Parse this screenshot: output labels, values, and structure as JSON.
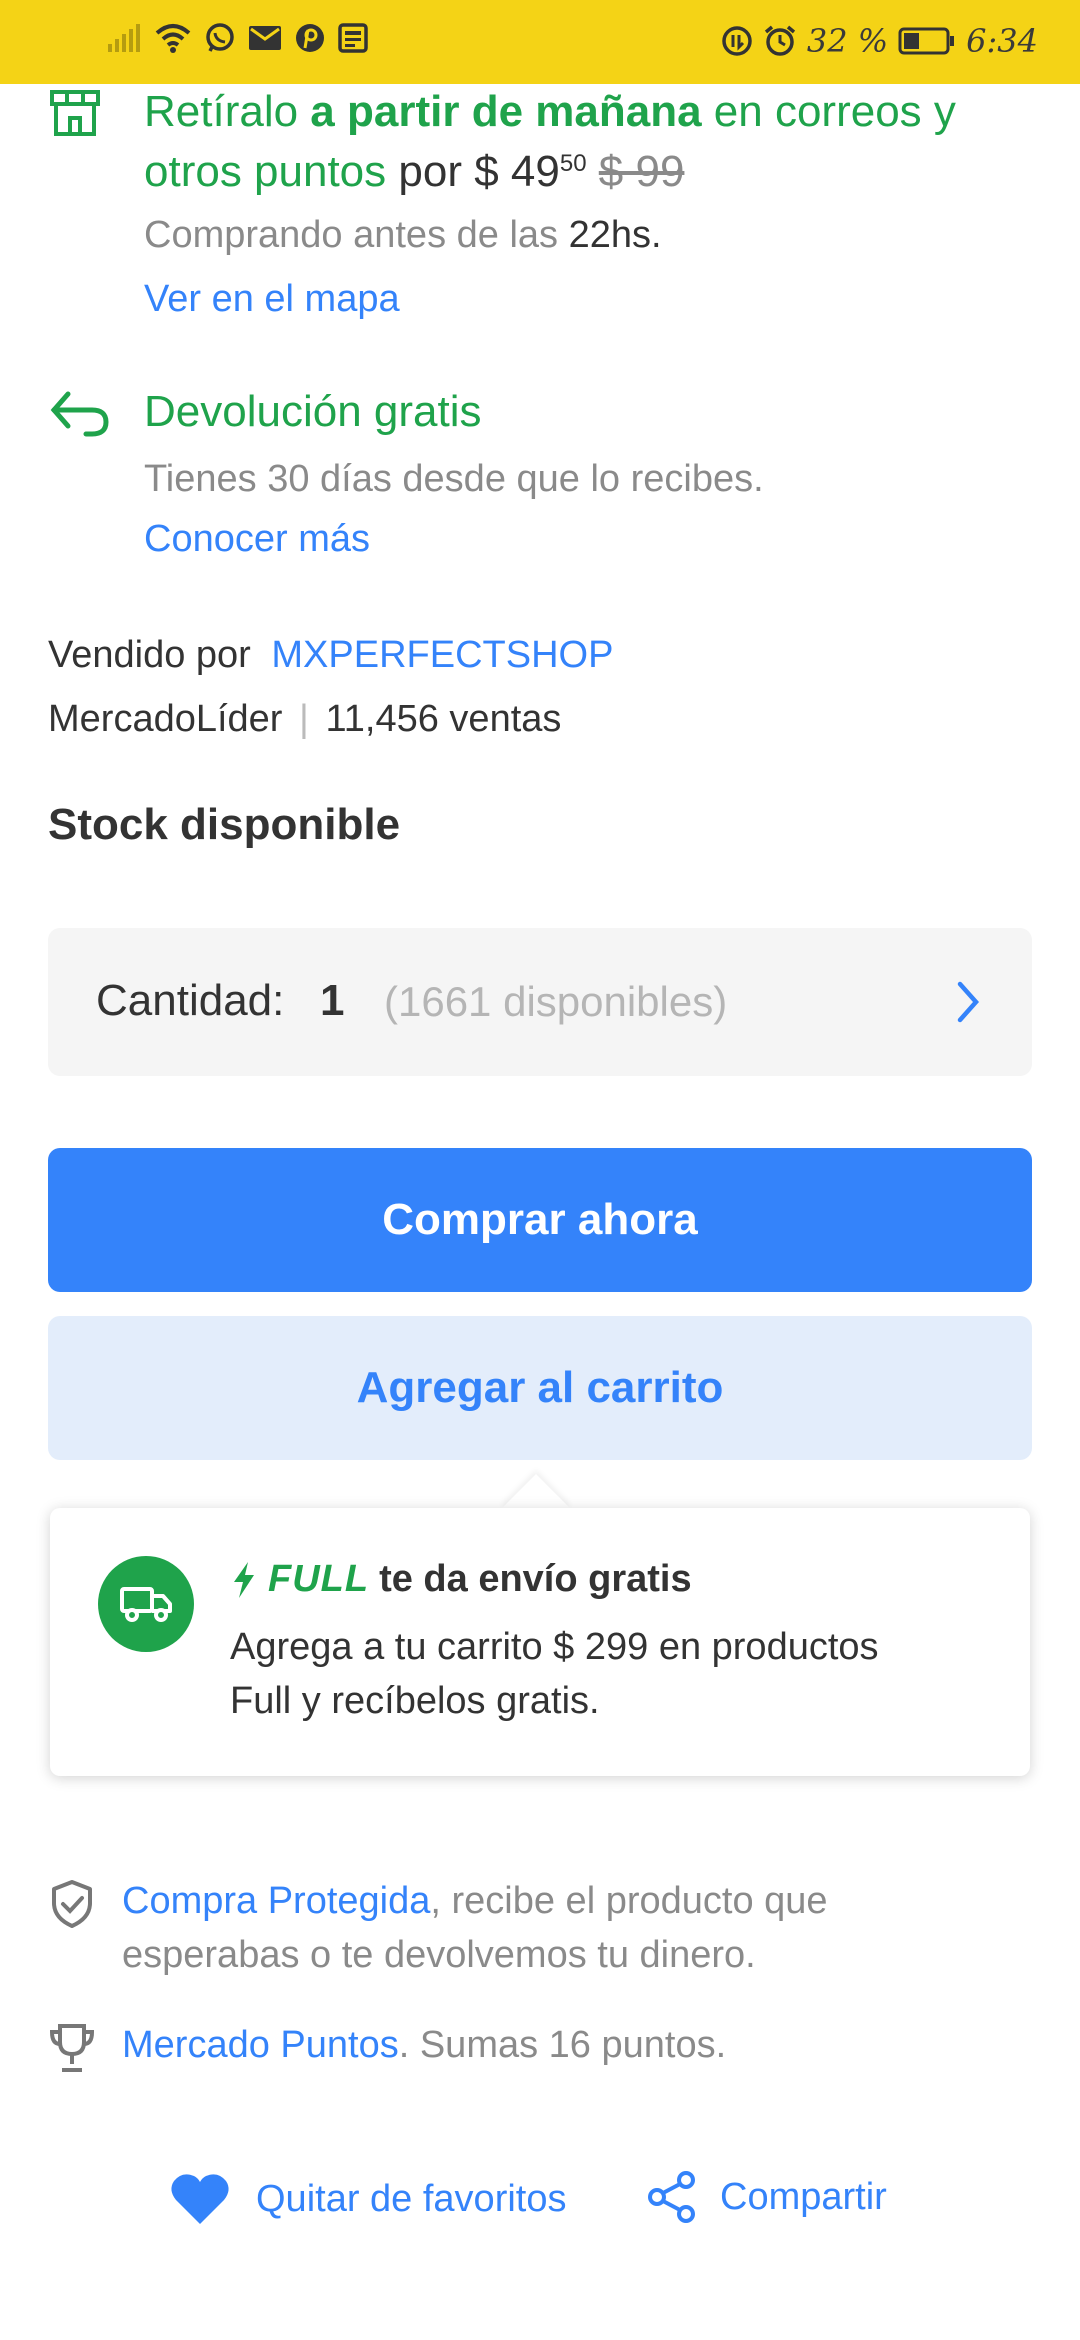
{
  "status_bar": {
    "battery_percent": "32 %",
    "time": "6:34"
  },
  "pickup": {
    "prefix": "Retíralo ",
    "highlight": "a partir de mañana",
    "suffix": " en correos y otros puntos",
    "por": " por ",
    "price_currency": "$ 49",
    "price_cents": "50",
    "old_price": "$ 99",
    "note_prefix": "Comprando antes de las ",
    "note_time": "22hs.",
    "map_link": "Ver en el mapa"
  },
  "returns": {
    "title": "Devolución gratis",
    "note": "Tienes 30 días desde que lo recibes.",
    "link": "Conocer más"
  },
  "seller": {
    "sold_by_label": "Vendido por",
    "name": "MXPERFECTSHOP",
    "level": "MercadoLíder",
    "separator": "|",
    "sales": "11,456 ventas"
  },
  "stock": {
    "title": "Stock disponible",
    "quantity_label": "Cantidad:",
    "quantity_value": "1",
    "available": "(1661 disponibles)"
  },
  "buttons": {
    "buy_now": "Comprar ahora",
    "add_to_cart": "Agregar al carrito"
  },
  "full_promo": {
    "brand": "FULL",
    "title_suffix": "te da envío gratis",
    "line1": "Agrega a tu carrito $ 299 en productos",
    "line2": "Full y recíbelos gratis."
  },
  "protection": {
    "link": "Compra Protegida",
    "line1_rest": ", recibe el producto que",
    "line2": "esperabas o te devolvemos tu dinero."
  },
  "points": {
    "link": "Mercado Puntos",
    "rest": ". Sumas 16 puntos."
  },
  "actions": {
    "favorite": "Quitar de favoritos",
    "share": "Compartir"
  },
  "colors": {
    "statusbar": "#f4d316",
    "green": "#1fa34b",
    "blue": "#3483fa",
    "light_blue": "#e3edfb"
  },
  "icons": [
    "store-icon",
    "return-arrow-icon",
    "chevron-right-icon",
    "truck-icon",
    "bolt-icon",
    "shield-check-icon",
    "trophy-icon",
    "heart-icon",
    "share-icon"
  ]
}
